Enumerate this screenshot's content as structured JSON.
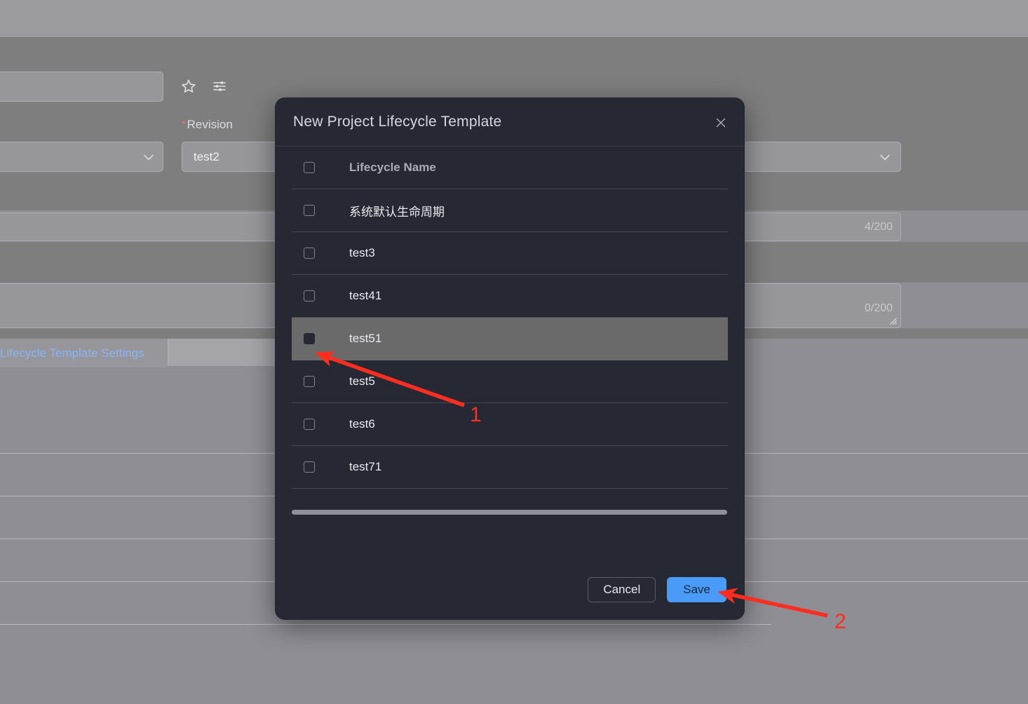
{
  "background": {
    "revision_label": "Revision",
    "revision_required_marker": "*",
    "revision_value": "test2",
    "counter_1": "4/200",
    "counter_2": "0/200",
    "tab_label": "Lifecycle Template Settings",
    "icons": {
      "favorite": "star-icon",
      "filter": "sliders-filter-icon",
      "dropdown": "chevron-down-icon"
    }
  },
  "modal": {
    "title": "New Project Lifecycle Template",
    "close_icon": "close-icon",
    "table": {
      "select_all_checkbox": "select-all-checkbox",
      "column_header": "Lifecycle Name",
      "rows": [
        {
          "name": "系统默认生命周期",
          "checked": false,
          "hovered": false
        },
        {
          "name": "test3",
          "checked": false,
          "hovered": false
        },
        {
          "name": "test41",
          "checked": false,
          "hovered": false
        },
        {
          "name": "test51",
          "checked": false,
          "hovered": true
        },
        {
          "name": "test5",
          "checked": false,
          "hovered": false
        },
        {
          "name": "test6",
          "checked": false,
          "hovered": false
        },
        {
          "name": "test71",
          "checked": false,
          "hovered": false
        }
      ]
    },
    "footer": {
      "cancel_label": "Cancel",
      "save_label": "Save"
    }
  },
  "annotations": {
    "step_1": "1",
    "step_2": "2",
    "arrow_color": "#ff2d1f"
  },
  "colors": {
    "modal_bg": "#262833",
    "save_button": "#4a9bf7",
    "tab_link": "#8ab4f8",
    "required_asterisk": "#e8717a",
    "row_hover": "#6a6a6a",
    "page_overlay": "#808080"
  }
}
